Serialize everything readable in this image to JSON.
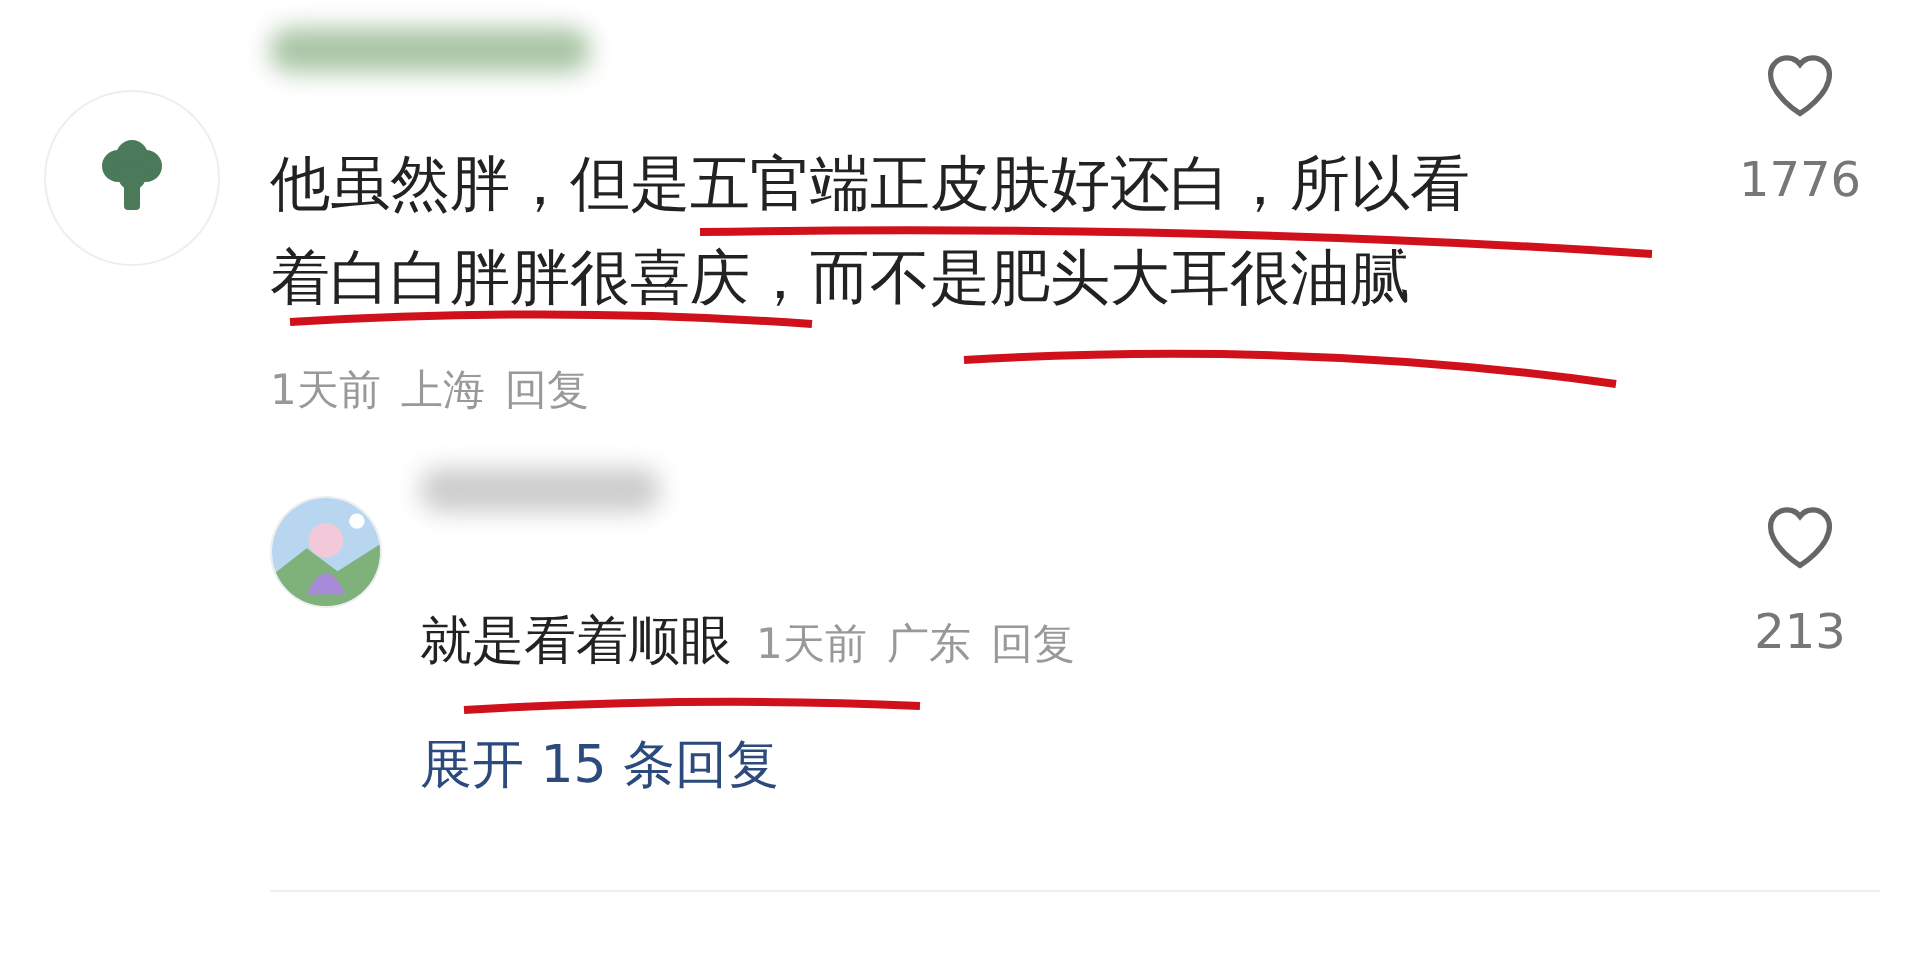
{
  "comment": {
    "lines": [
      "他虽然胖，但是五官端正皮肤好还白，所以看",
      "着白白胖胖很喜庆，而不是肥头大耳很油腻"
    ],
    "time": "1天前",
    "location": "上海",
    "reply_label": "回复",
    "likes": "1776",
    "liked": false
  },
  "reply": {
    "text": "就是看着顺眼",
    "time": "1天前",
    "location": "广东",
    "reply_label": "回复",
    "likes": "213",
    "liked": false
  },
  "expand": "展开 15 条回复"
}
